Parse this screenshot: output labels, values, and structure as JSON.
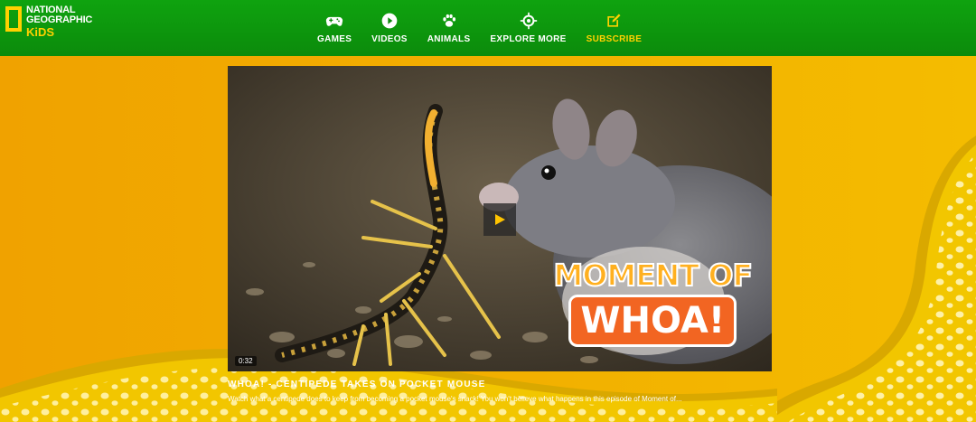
{
  "brand": {
    "line1": "NATIONAL",
    "line2": "GEOGRAPHIC",
    "line3": "KiDS"
  },
  "nav": {
    "items": [
      {
        "label": "GAMES",
        "icon": "gamepad-icon"
      },
      {
        "label": "VIDEOS",
        "icon": "play-circle-icon"
      },
      {
        "label": "ANIMALS",
        "icon": "paw-icon"
      },
      {
        "label": "EXPLORE MORE",
        "icon": "crosshair-icon"
      },
      {
        "label": "SUBSCRIBE",
        "icon": "edit-icon"
      }
    ]
  },
  "video": {
    "duration": "0:32",
    "overlay_top": "MOMENT OF",
    "overlay_bottom": "WHOA!",
    "title": "WHOA! - CENTIPEDE TAKES ON POCKET MOUSE",
    "description": "Watch what a centipede does to keep from becoming a pocket mouse's snack! You won't believe what happens in this episode of Moment of..."
  },
  "colors": {
    "header_green": "#0fa30f",
    "brand_yellow": "#ffd100",
    "background_orange": "#f0a500",
    "accent_orange": "#f26522"
  }
}
